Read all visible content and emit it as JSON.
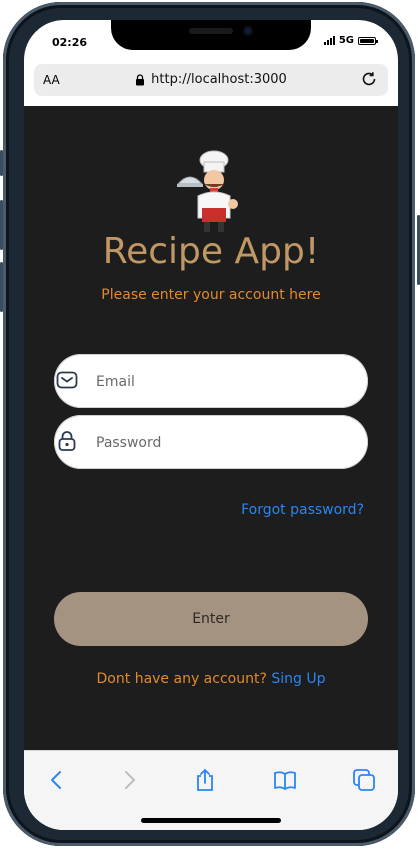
{
  "status_bar": {
    "time": "02:26",
    "network": "5G"
  },
  "browser": {
    "text_size_label": "AA",
    "url": "http://localhost:3000"
  },
  "app": {
    "title": "Recipe App!",
    "subtitle": "Please enter your account here",
    "email_placeholder": "Email",
    "email_value": "",
    "password_placeholder": "Password",
    "password_value": "",
    "forgot_password": "Forgot password?",
    "enter_button": "Enter",
    "signup_prompt": "Dont have any account?",
    "signup_link": "Sing Up"
  },
  "icons": {
    "email": "envelope-icon",
    "password": "lock-icon",
    "logo": "chef-illustration"
  },
  "colors": {
    "app_background": "#1d1d1d",
    "title": "#c09765",
    "accent_orange": "#e08a2e",
    "link_blue": "#2a86f0",
    "button": "#a59382"
  }
}
